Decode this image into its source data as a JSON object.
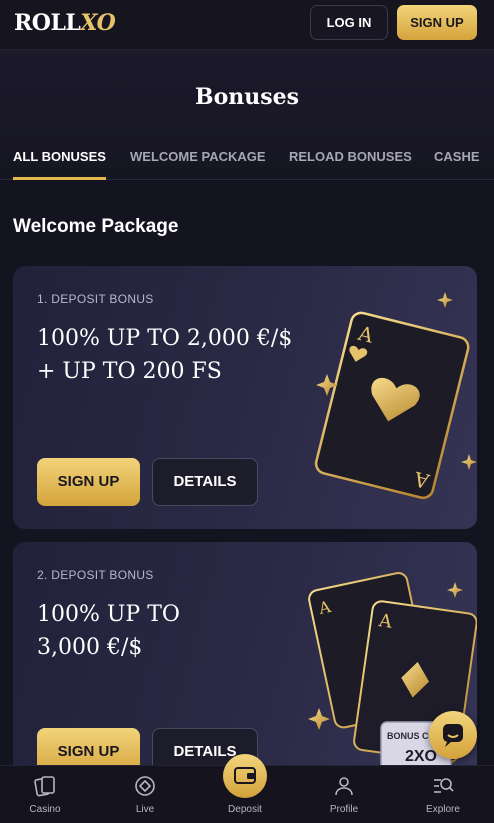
{
  "header": {
    "logo_roll": "ROLL",
    "logo_xo": "XO",
    "login_label": "LOG IN",
    "signup_label": "SIGN UP"
  },
  "page": {
    "title": "Bonuses"
  },
  "tabs": [
    {
      "label": "ALL BONUSES",
      "active": true
    },
    {
      "label": "WELCOME PACKAGE",
      "active": false
    },
    {
      "label": "RELOAD BONUSES",
      "active": false
    },
    {
      "label": "CASHE",
      "active": false
    }
  ],
  "section": {
    "title": "Welcome Package"
  },
  "cards": [
    {
      "label": "1. DEPOSIT BONUS",
      "headline_line1": "100% UP TO 2,000 €/$",
      "headline_line2": "+ UP TO 200 FS",
      "signup_label": "SIGN UP",
      "details_label": "DETAILS"
    },
    {
      "label": "2. DEPOSIT BONUS",
      "headline_line1": "100% UP TO",
      "headline_line2": "3,000 €/$",
      "signup_label": "SIGN UP",
      "details_label": "DETAILS",
      "badge_top": "BONUS CO",
      "badge_value": "2XO"
    }
  ],
  "bottom_nav": [
    {
      "label": "Casino",
      "icon": "cards-icon"
    },
    {
      "label": "Live",
      "icon": "chip-icon"
    },
    {
      "label": "Deposit",
      "icon": "wallet-icon"
    },
    {
      "label": "Profile",
      "icon": "user-icon"
    },
    {
      "label": "Explore",
      "icon": "search-list-icon"
    }
  ],
  "colors": {
    "accent_gold": "#e2b84f",
    "background": "#141320",
    "card_bg": "#2b2a46"
  }
}
